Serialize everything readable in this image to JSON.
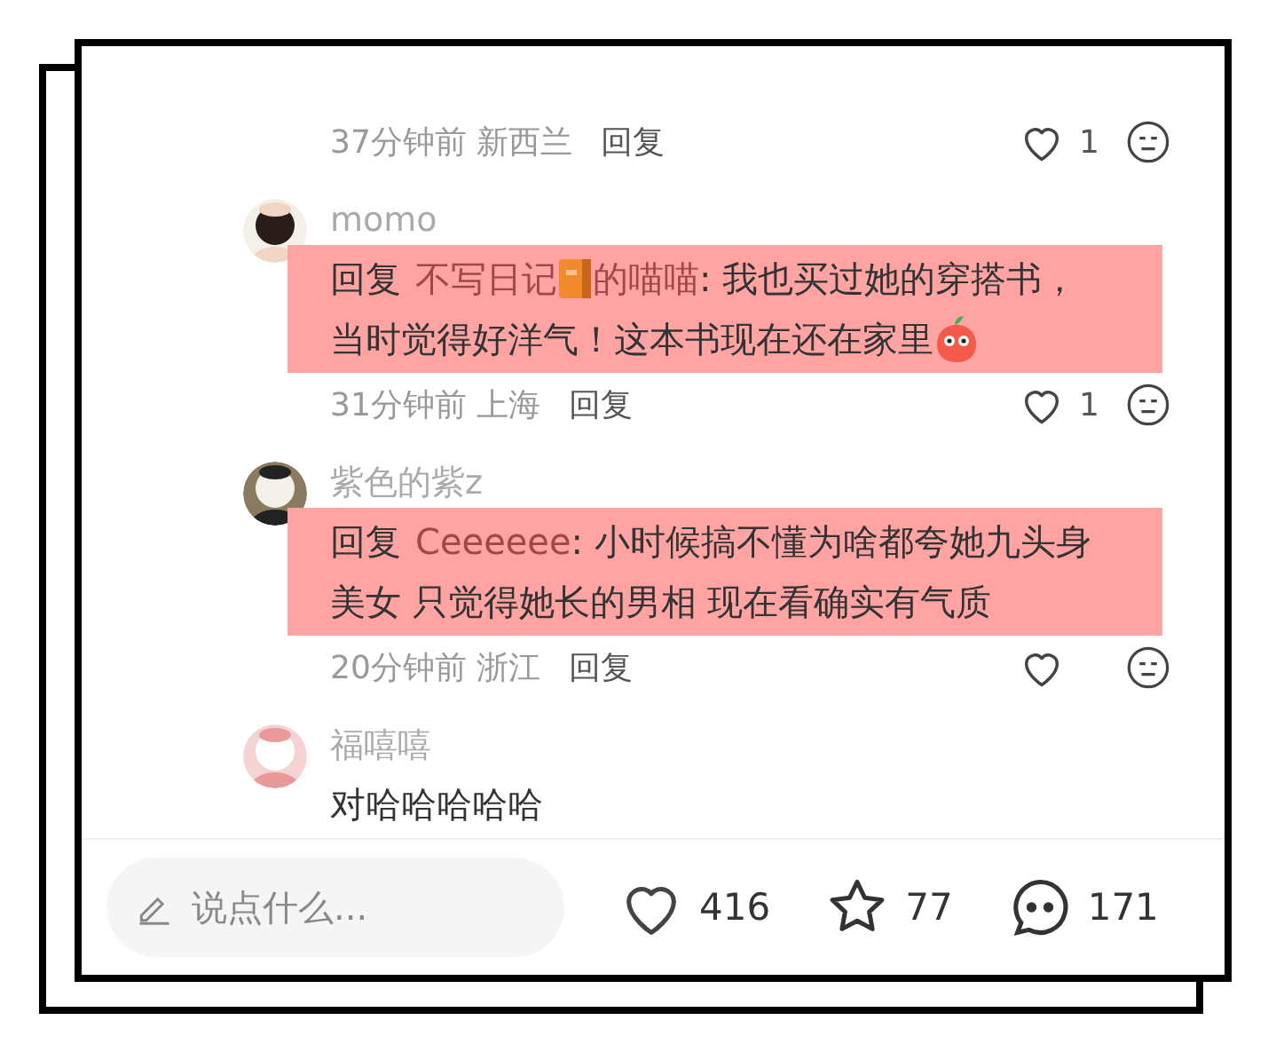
{
  "comments": [
    {
      "time": "37分钟前",
      "location": "新西兰",
      "reply_label": "回复",
      "likes": "1"
    },
    {
      "user": "momo",
      "avatar": {
        "kind": "picture"
      },
      "highlighted": true,
      "lines": [
        [
          {
            "kind": "label",
            "text": "回复"
          },
          {
            "kind": "mention",
            "text": "不写日记"
          },
          {
            "kind": "book"
          },
          {
            "kind": "mention",
            "text": "的喵喵"
          },
          {
            "kind": "text",
            "text": ": 我也买过她的穿搭书，"
          }
        ],
        [
          {
            "kind": "text",
            "text": "当时觉得好洋气！这本书现在还在家里"
          },
          {
            "kind": "sticker"
          }
        ]
      ],
      "time": "31分钟前",
      "location": "上海",
      "reply_label": "回复",
      "likes": "1"
    },
    {
      "user": "紫色的紫z",
      "avatar": {
        "kind": "picture"
      },
      "highlighted": true,
      "lines": [
        [
          {
            "kind": "label",
            "text": "回复"
          },
          {
            "kind": "mention",
            "text": "Ceeeeee"
          },
          {
            "kind": "text",
            "text": ": 小时候搞不懂为啥都夸她九头身"
          }
        ],
        [
          {
            "kind": "text",
            "text": "美女 只觉得她长的男相 现在看确实有气质"
          }
        ]
      ],
      "time": "20分钟前",
      "location": "浙江",
      "reply_label": "回复"
    },
    {
      "user": "福嘻嘻",
      "avatar": {
        "kind": "picture"
      },
      "highlighted": false,
      "lines": [
        [
          {
            "kind": "text",
            "text": "对哈哈哈哈哈"
          }
        ]
      ]
    }
  ],
  "bottom_bar": {
    "input": {
      "placeholder": "说点什么..."
    },
    "likes": "416",
    "stars": "77",
    "comments": "171"
  }
}
